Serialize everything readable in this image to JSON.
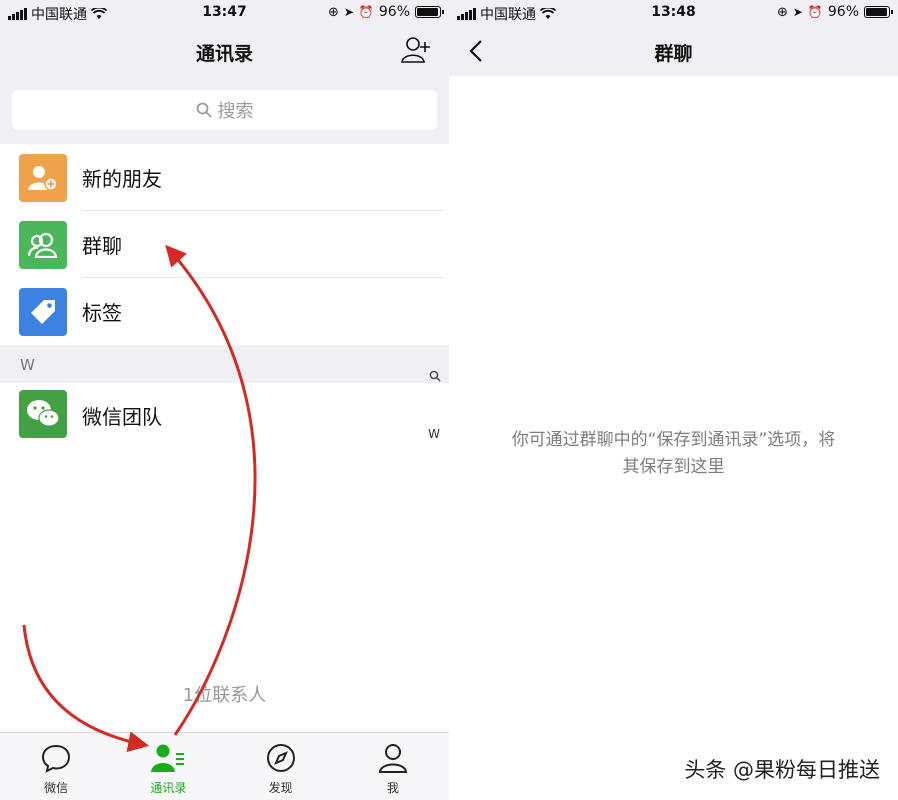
{
  "left": {
    "status": {
      "carrier": "中国联通",
      "time": "13:47",
      "battery": "96%"
    },
    "nav": {
      "title": "通讯录"
    },
    "search": {
      "placeholder": "搜索"
    },
    "items": [
      {
        "label": "新的朋友",
        "icon": "new-friend-icon",
        "color": "#f0a24a"
      },
      {
        "label": "群聊",
        "icon": "group-chat-icon",
        "color": "#4cb75a"
      },
      {
        "label": "标签",
        "icon": "tag-icon",
        "color": "#3d82e0"
      }
    ],
    "section": "W",
    "contacts": [
      {
        "label": "微信团队",
        "icon": "wechat-icon",
        "color": "#44a044"
      }
    ],
    "index": {
      "w": "W"
    },
    "contact_count": "1位联系人",
    "tabs": [
      {
        "label": "微信",
        "icon": "chat-bubble-icon",
        "active": false
      },
      {
        "label": "通讯录",
        "icon": "contacts-icon",
        "active": true
      },
      {
        "label": "发现",
        "icon": "compass-icon",
        "active": false
      },
      {
        "label": "我",
        "icon": "person-icon",
        "active": false
      }
    ],
    "accent": "#1aad19",
    "arrow_color": "#d42a24"
  },
  "right": {
    "status": {
      "carrier": "中国联通",
      "time": "13:48",
      "battery": "96%"
    },
    "nav": {
      "title": "群聊"
    },
    "empty_message_line1": "你可通过群聊中的“保存到通讯录”选项，将",
    "empty_message_line2": "其保存到这里"
  },
  "watermark": "头条 @果粉每日推送"
}
